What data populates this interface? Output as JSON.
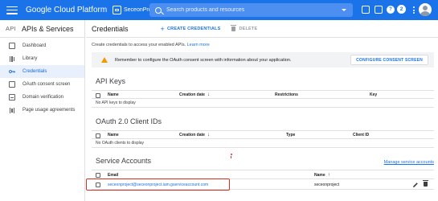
{
  "topbar": {
    "brand": "Google Cloud Platform",
    "project_name": "SeceonProject",
    "search_placeholder": "Search products and resources",
    "notifications_count": "2",
    "colors": {
      "background": "#1a73e8"
    }
  },
  "sidebar": {
    "api_label": "API",
    "title": "APIs & Services",
    "items": [
      {
        "label": "Dashboard",
        "icon": "dashboard-icon"
      },
      {
        "label": "Library",
        "icon": "library-icon"
      },
      {
        "label": "Credentials",
        "icon": "key-icon",
        "active": true
      },
      {
        "label": "OAuth consent screen",
        "icon": "consent-icon"
      },
      {
        "label": "Domain verification",
        "icon": "domain-icon"
      },
      {
        "label": "Page usage agreements",
        "icon": "settings-list-icon"
      }
    ]
  },
  "main": {
    "title": "Credentials",
    "create_label": "CREATE CREDENTIALS",
    "delete_label": "DELETE",
    "intro_text": "Create credentials to access your enabled APIs.",
    "learn_more": "Learn more",
    "banner": {
      "text": "Remember to configure the OAuth consent screen with information about your application.",
      "button": "CONFIGURE CONSENT SCREEN"
    },
    "api_keys": {
      "title": "API Keys",
      "columns": [
        "Name",
        "Creation date",
        "Restrictions",
        "Key"
      ],
      "empty": "No API keys to display"
    },
    "oauth": {
      "title": "OAuth 2.0 Client IDs",
      "columns": [
        "Name",
        "Creation date",
        "Type",
        "Client ID"
      ],
      "empty": "No OAuth clients to display"
    },
    "service_accounts": {
      "title": "Service Accounts",
      "manage_link": "Manage service accounts",
      "columns": [
        "Email",
        "Name"
      ],
      "rows": [
        {
          "email": "seceonproject@seceonproject.iam.gserviceaccount.com",
          "name": "seceonproject"
        }
      ]
    }
  }
}
